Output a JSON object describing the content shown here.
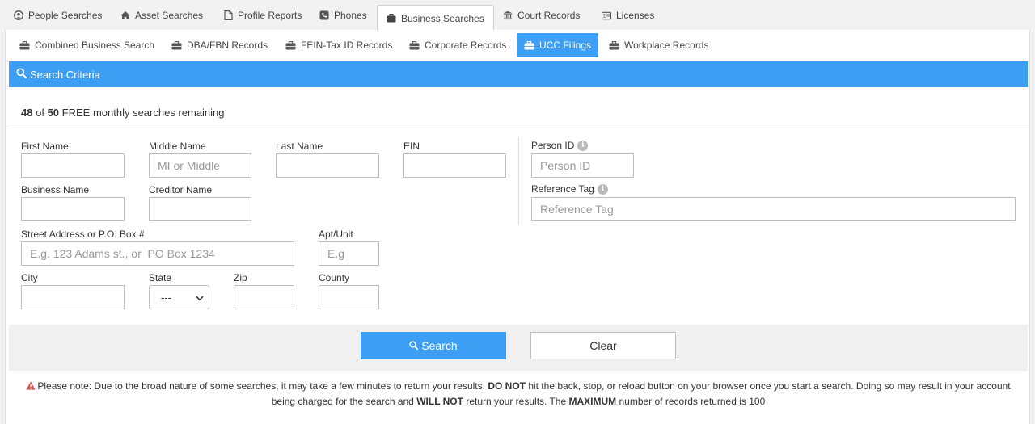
{
  "top_tabs": [
    {
      "label": "People Searches",
      "icon": "user-circle-icon"
    },
    {
      "label": "Asset Searches",
      "icon": "home-icon"
    },
    {
      "label": "Profile Reports",
      "icon": "file-icon"
    },
    {
      "label": "Phones",
      "icon": "phone-icon"
    },
    {
      "label": "Business Searches",
      "icon": "briefcase-icon",
      "active": true
    },
    {
      "label": "Court Records",
      "icon": "courthouse-icon"
    },
    {
      "label": "Licenses",
      "icon": "id-card-icon"
    }
  ],
  "sub_tabs": [
    {
      "label": "Combined Business Search"
    },
    {
      "label": "DBA/FBN Records"
    },
    {
      "label": "FEIN-Tax ID Records"
    },
    {
      "label": "Corporate Records"
    },
    {
      "label": "UCC Filings",
      "active": true
    },
    {
      "label": "Workplace Records"
    }
  ],
  "criteria": {
    "title": "Search Criteria"
  },
  "remaining": {
    "used": "48",
    "of": "of",
    "total": "50",
    "text": "FREE monthly searches remaining"
  },
  "fields": {
    "first_name": {
      "label": "First Name",
      "value": "",
      "placeholder": ""
    },
    "middle_name": {
      "label": "Middle Name",
      "value": "",
      "placeholder": "MI or Middle"
    },
    "last_name": {
      "label": "Last Name",
      "value": "",
      "placeholder": ""
    },
    "ein": {
      "label": "EIN",
      "value": "",
      "placeholder": ""
    },
    "person_id": {
      "label": "Person ID",
      "value": "",
      "placeholder": "Person ID"
    },
    "business_name": {
      "label": "Business Name",
      "value": "",
      "placeholder": ""
    },
    "creditor_name": {
      "label": "Creditor Name",
      "value": "",
      "placeholder": ""
    },
    "reference_tag": {
      "label": "Reference Tag",
      "value": "",
      "placeholder": "Reference Tag"
    },
    "street": {
      "label": "Street Address or P.O. Box #",
      "value": "",
      "placeholder": "E.g. 123 Adams st., or  PO Box 1234"
    },
    "apt": {
      "label": "Apt/Unit",
      "value": "",
      "placeholder": "E.g"
    },
    "city": {
      "label": "City",
      "value": "",
      "placeholder": ""
    },
    "state": {
      "label": "State",
      "selected": "---"
    },
    "zip": {
      "label": "Zip",
      "value": "",
      "placeholder": ""
    },
    "county": {
      "label": "County",
      "value": "",
      "placeholder": ""
    }
  },
  "buttons": {
    "search": "Search",
    "clear": "Clear"
  },
  "note": {
    "part1": "Please note: Due to the broad nature of some searches, it may take a few minutes to return your results. ",
    "bold1": "DO NOT",
    "part2": " hit the back, stop, or reload button on your browser once you start a search. Doing so may result in your account being charged for the search and ",
    "bold2": "WILL NOT",
    "part3": " return your results. The ",
    "bold3": "MAXIMUM",
    "part4": " number of records returned is 100"
  },
  "colors": {
    "accent": "#3d9ff4",
    "warning": "#d9534f"
  }
}
